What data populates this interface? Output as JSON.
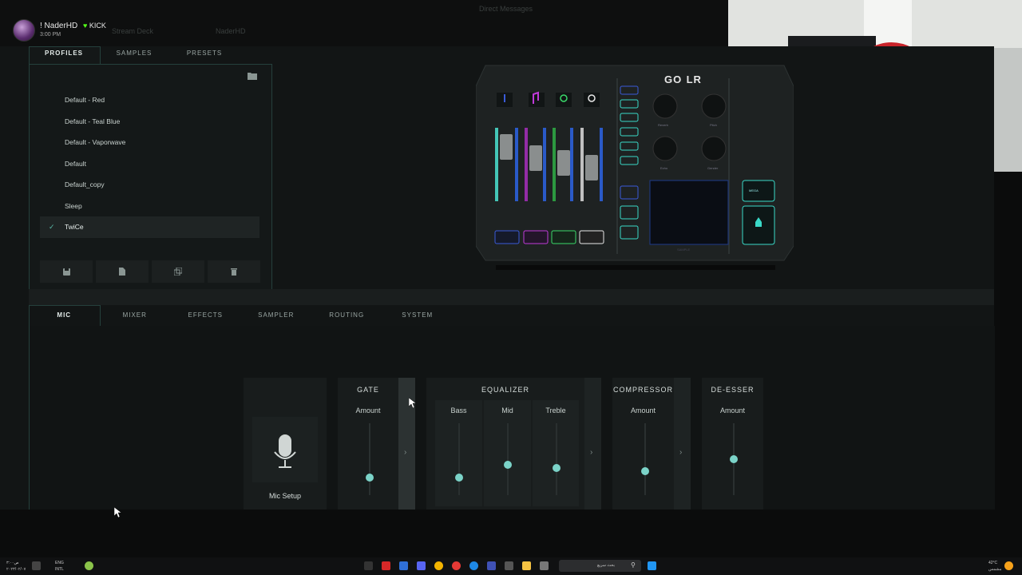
{
  "stream": {
    "username": "! NaderHD",
    "badge": "KICK",
    "time": "3:00 PM",
    "ghost_title": "Direct Messages",
    "ghost_left": "Stream Deck",
    "ghost_right": "NaderHD"
  },
  "profiles": {
    "tabs": [
      "PROFILES",
      "SAMPLES",
      "PRESETS"
    ],
    "items": [
      "Default - Red",
      "Default - Teal Blue",
      "Default - Vaporwave",
      "Default",
      "Default_copy",
      "Sleep",
      "TwiCe"
    ],
    "selected_index": 6,
    "actions": [
      "save-icon",
      "new-file-icon",
      "copy-icon",
      "delete-icon"
    ]
  },
  "device": {
    "logo": "GO",
    "logo_suffix": "LR",
    "knob_labels": [
      "Reverb",
      "Pitch",
      "Echo",
      "Gender"
    ],
    "fx_label": "MEGA",
    "side_label": "SAMPLE"
  },
  "main_tabs": [
    "MIC",
    "MIXER",
    "EFFECTS",
    "SAMPLER",
    "ROUTING",
    "SYSTEM"
  ],
  "mic_panel": {
    "mic_setup_label": "Mic Setup",
    "gate": {
      "title": "GATE",
      "amount_label": "Amount",
      "level": 0.25
    },
    "equalizer": {
      "title": "EQUALIZER",
      "bands": [
        {
          "label": "Bass",
          "level": 0.25
        },
        {
          "label": "Mid",
          "level": 0.42
        },
        {
          "label": "Treble",
          "level": 0.38
        }
      ]
    },
    "compressor": {
      "title": "COMPRESSOR",
      "amount_label": "Amount",
      "level": 0.33
    },
    "deesser": {
      "title": "DE-ESSER",
      "amount_label": "Amount",
      "level": 0.5
    }
  },
  "taskbar": {
    "time": "ص٣:٠٠",
    "date": "٢٠٢٣/٠٢/٠٧",
    "lang_top": "ENG",
    "lang_bottom": "INTL",
    "search_placeholder": "بحث سريع",
    "weather_temp": "42°C",
    "weather_desc": "مشمس"
  },
  "colors": {
    "accent": "#7bd3c8",
    "panel_border": "#25403c",
    "kick_green": "#53fc18"
  }
}
